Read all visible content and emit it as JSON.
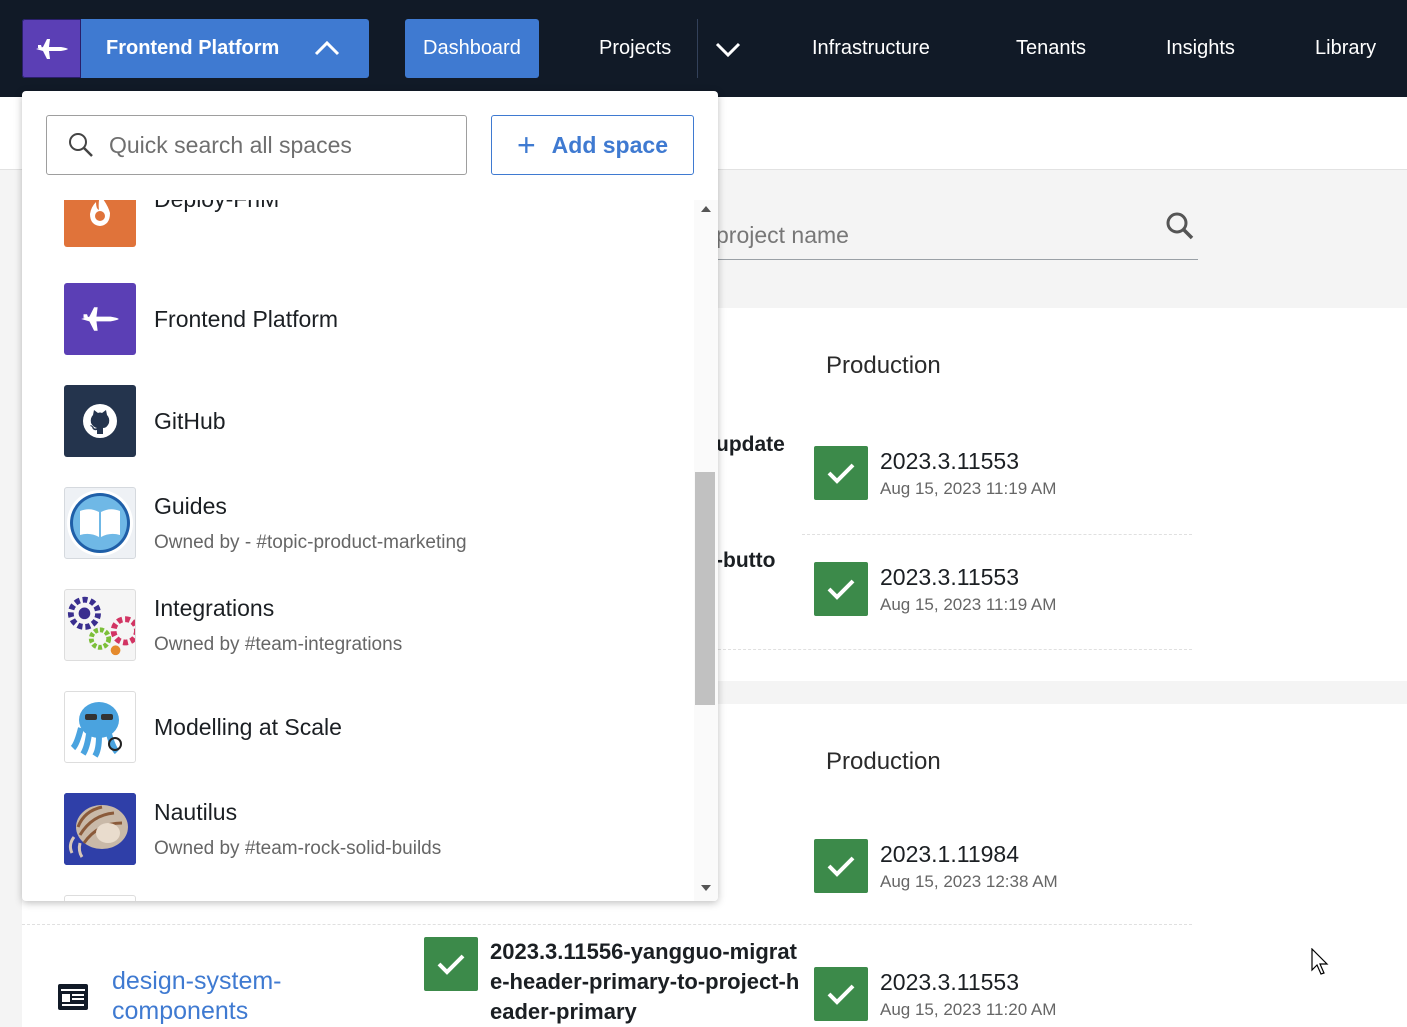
{
  "topnav": {
    "current_space": "Frontend Platform",
    "links": {
      "dashboard": "Dashboard",
      "projects": "Projects",
      "infrastructure": "Infrastructure",
      "tenants": "Tenants",
      "insights": "Insights",
      "library": "Library"
    },
    "active": "Dashboard"
  },
  "dropdown": {
    "search_placeholder": "Quick search all spaces",
    "add_space_label": "Add space",
    "spaces": [
      {
        "name": "Deploy-FnM",
        "owner": ""
      },
      {
        "name": "Frontend Platform",
        "owner": ""
      },
      {
        "name": "GitHub",
        "owner": ""
      },
      {
        "name": "Guides",
        "owner": "Owned by - #topic-product-marketing"
      },
      {
        "name": "Integrations",
        "owner": "Owned by #team-integrations"
      },
      {
        "name": "Modelling at Scale",
        "owner": ""
      },
      {
        "name": "Nautilus",
        "owner": "Owned by #team-rock-solid-builds"
      }
    ]
  },
  "page": {
    "filter_placeholder_visible": "project name",
    "group1": {
      "env": "Production",
      "rows": [
        {
          "partial_release": "update",
          "version": "2023.3.11553",
          "date": "Aug 15, 2023 11:19 AM"
        },
        {
          "partial_release": "-butto",
          "version": "2023.3.11553",
          "date": "Aug 15, 2023 11:19 AM"
        }
      ]
    },
    "group2": {
      "env": "Production",
      "rows": [
        {
          "version": "2023.1.11984",
          "date": "Aug 15, 2023 12:38 AM"
        },
        {
          "project": "design-system-components",
          "dev_release": "2023.3.11556-yangguo-migrate-header-primary-to-project-header-primary",
          "version": "2023.3.11553",
          "date": "Aug 15, 2023 11:20 AM"
        }
      ]
    }
  },
  "colors": {
    "nav_bg": "#111a27",
    "accent": "#3f7ad1",
    "success": "#3c8a4a",
    "space_purple": "#5b3fb5"
  }
}
